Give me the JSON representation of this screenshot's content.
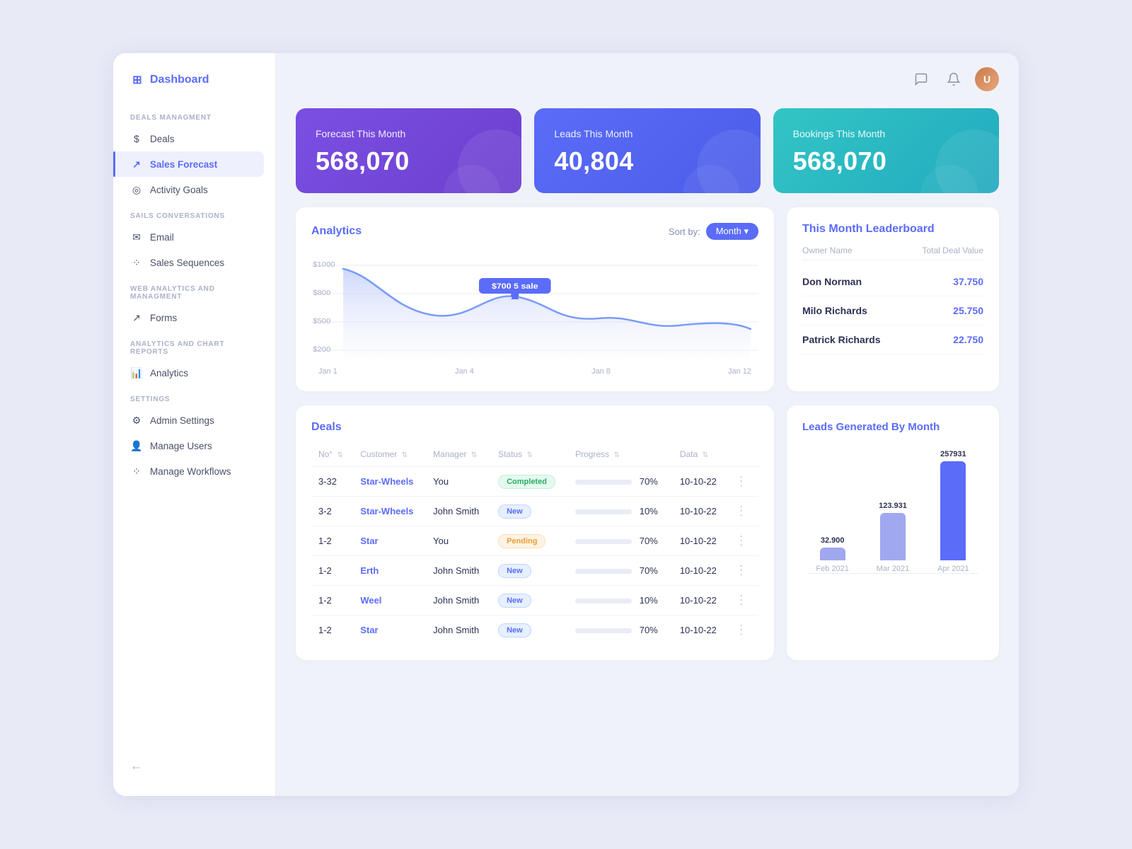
{
  "sidebar": {
    "logo": "Dashboard",
    "logo_icon": "⊞",
    "sections": [
      {
        "title": "DEALS MANAGMENT",
        "items": [
          {
            "icon": "$",
            "label": "Deals",
            "active": false
          },
          {
            "icon": "↗",
            "label": "Sales Forecast",
            "active": true
          },
          {
            "icon": "◎",
            "label": "Activity Goals",
            "active": false
          }
        ]
      },
      {
        "title": "SAILS CONVERSATIONS",
        "items": [
          {
            "icon": "✉",
            "label": "Email",
            "active": false
          },
          {
            "icon": "⁘",
            "label": "Sales Sequences",
            "active": false
          }
        ]
      },
      {
        "title": "WEB ANALYTICS AND MANAGMENT",
        "items": [
          {
            "icon": "↗",
            "label": "Forms",
            "active": false
          }
        ]
      },
      {
        "title": "ANALYTICS AND CHART REPORTS",
        "items": [
          {
            "icon": "📊",
            "label": "Analytics",
            "active": false
          }
        ]
      },
      {
        "title": "SETTINGS",
        "items": [
          {
            "icon": "⚙",
            "label": "Admin Settings",
            "active": false
          },
          {
            "icon": "👤",
            "label": "Manage Users",
            "active": false
          },
          {
            "icon": "⁘",
            "label": "Manage Workflows",
            "active": false
          }
        ]
      }
    ],
    "back_label": "←"
  },
  "topbar": {
    "chat_icon": "💬",
    "bell_icon": "🔔",
    "avatar_text": "U"
  },
  "metric_cards": [
    {
      "title": "Forecast This Month",
      "value": "568,070",
      "type": "purple"
    },
    {
      "title": "Leads This Month",
      "value": "40,804",
      "type": "blue-purple"
    },
    {
      "title": "Bookings This Month",
      "value": "568,070",
      "type": "teal"
    }
  ],
  "analytics": {
    "title": "Analytics",
    "sort_by_label": "Sort by:",
    "sort_btn_label": "Month ▾",
    "tooltip_text": "$700  5 sale",
    "x_labels": [
      "Jan 1",
      "Jan 4",
      "Jan 8",
      "Jan 12"
    ],
    "y_labels": [
      "$1000",
      "$800",
      "$500",
      "$200"
    ]
  },
  "leaderboard": {
    "title": "This Month Leaderboard",
    "col_owner": "Owner Name",
    "col_value": "Total Deal Value",
    "rows": [
      {
        "name": "Don Norman",
        "value": "37.750"
      },
      {
        "name": "Milo Richards",
        "value": "25.750"
      },
      {
        "name": "Patrick Richards",
        "value": "22.750"
      }
    ]
  },
  "deals": {
    "title": "Deals",
    "columns": [
      "No°",
      "Customer",
      "Manager",
      "Status",
      "Progress",
      "Data",
      ""
    ],
    "rows": [
      {
        "no": "3-32",
        "customer": "Star-Wheels",
        "manager": "You",
        "status": "Completed",
        "status_type": "completed",
        "progress": 70,
        "data": "10-10-22"
      },
      {
        "no": "3-2",
        "customer": "Star-Wheels",
        "manager": "John Smith",
        "status": "New",
        "status_type": "new",
        "progress": 10,
        "data": "10-10-22"
      },
      {
        "no": "1-2",
        "customer": "Star",
        "manager": "You",
        "status": "Pending",
        "status_type": "pending",
        "progress": 70,
        "data": "10-10-22"
      },
      {
        "no": "1-2",
        "customer": "Erth",
        "manager": "John Smith",
        "status": "New",
        "status_type": "new",
        "progress": 70,
        "data": "10-10-22"
      },
      {
        "no": "1-2",
        "customer": "Weel",
        "manager": "John Smith",
        "status": "New",
        "status_type": "new",
        "progress": 10,
        "data": "10-10-22"
      },
      {
        "no": "1-2",
        "customer": "Star",
        "manager": "John Smith",
        "status": "New",
        "status_type": "new",
        "progress": 70,
        "data": "10-10-22"
      }
    ]
  },
  "leads_chart": {
    "title": "Leads Generated By Month",
    "bars": [
      {
        "label": "Feb 2021",
        "value": 32900,
        "display": "32.900",
        "active": false
      },
      {
        "label": "Mar 2021",
        "value": 123931,
        "display": "123.931",
        "active": false
      },
      {
        "label": "Apr 2021",
        "value": 257931,
        "display": "257931",
        "active": true
      }
    ],
    "max_value": 257931
  }
}
